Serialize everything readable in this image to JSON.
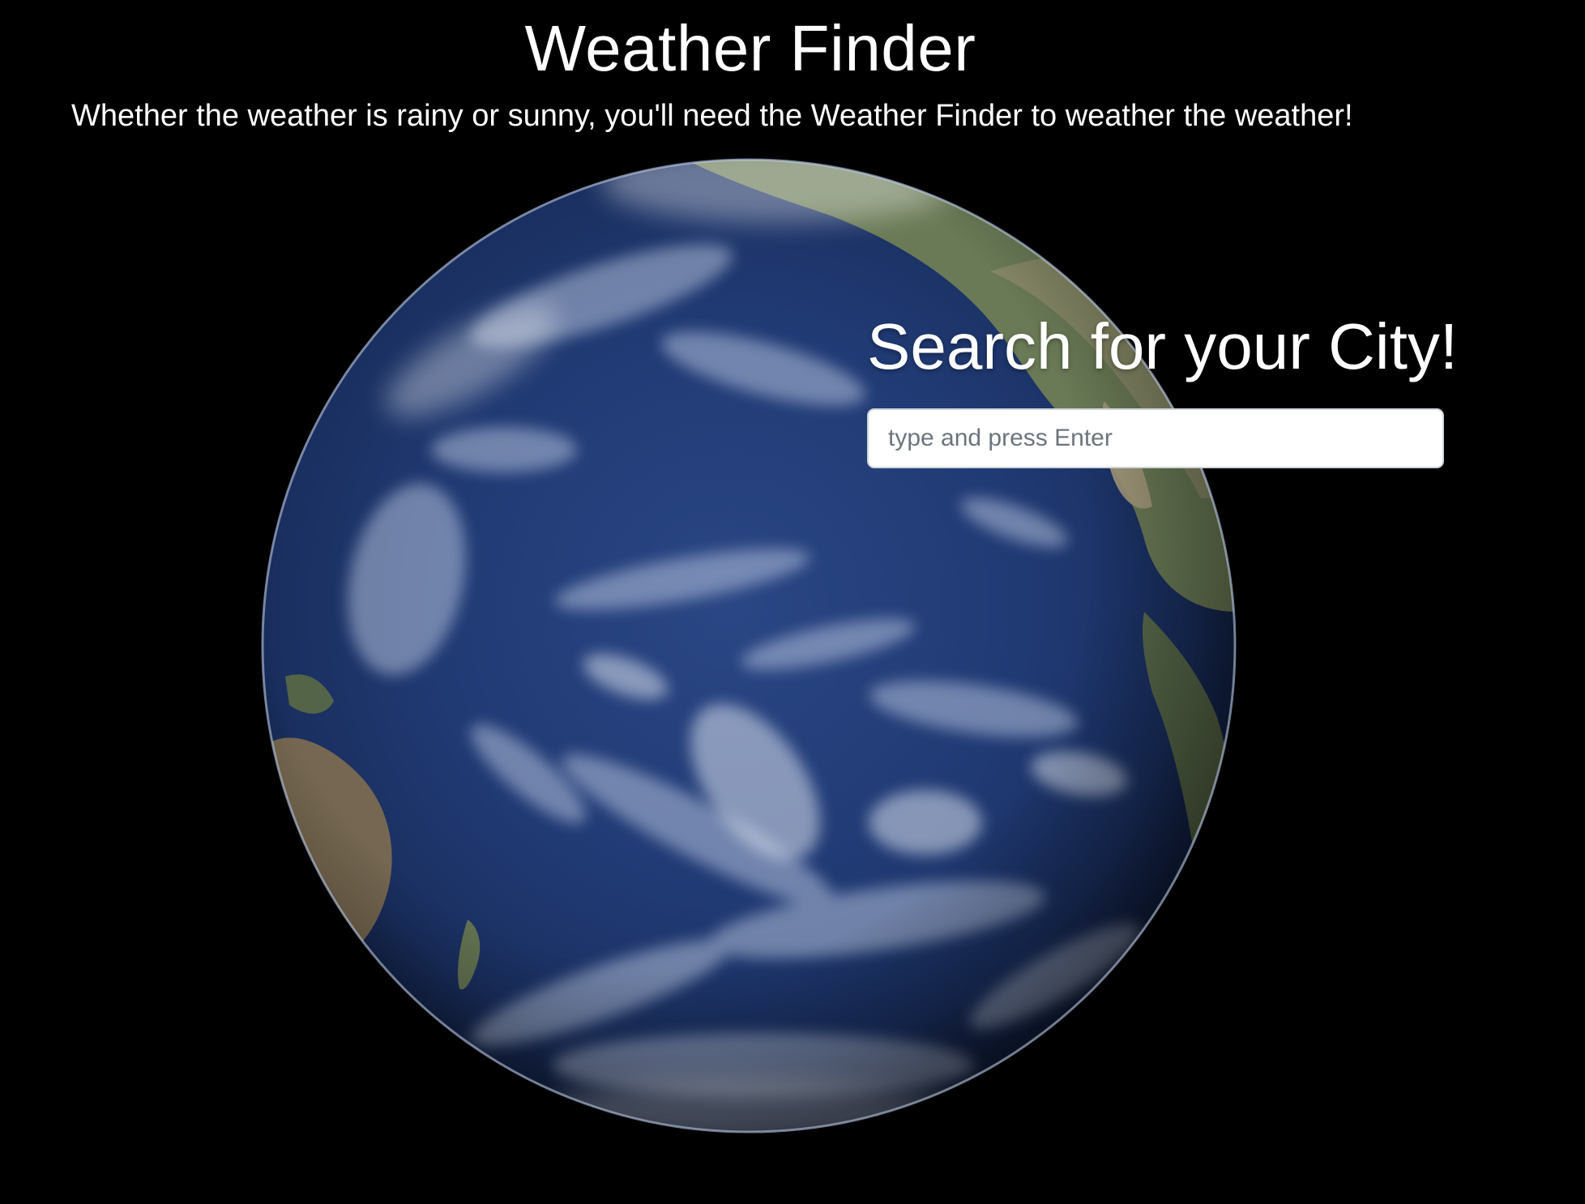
{
  "header": {
    "title": "Weather Finder",
    "tagline": "Whether the weather is rainy or sunny, you'll need the Weather Finder to weather the weather!"
  },
  "search": {
    "heading": "Search for your City!",
    "placeholder": "type and press Enter",
    "value": ""
  },
  "colors": {
    "background": "#000000",
    "text": "#ffffff",
    "ocean": "#1e3468",
    "input_border": "#cfd4da"
  }
}
